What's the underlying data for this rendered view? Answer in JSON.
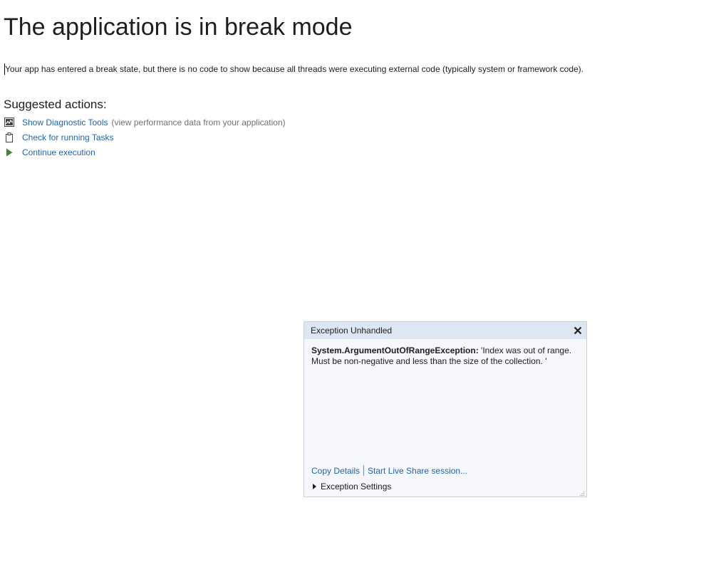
{
  "title": "The application is in break mode",
  "message": "Your app has entered a break state, but there is no code to show because all threads were executing external code (typically system or framework code).",
  "suggested_actions": {
    "heading": "Suggested actions:",
    "items": [
      {
        "label": "Show Diagnostic Tools",
        "hint": "(view performance data from your application)",
        "icon": "diagnostic-tools-icon"
      },
      {
        "label": "Check for running Tasks",
        "hint": "",
        "icon": "clipboard-icon"
      },
      {
        "label": "Continue execution",
        "hint": "",
        "icon": "play-icon"
      }
    ]
  },
  "exception_popup": {
    "title": "Exception Unhandled",
    "exception_type": "System.ArgumentOutOfRangeException:",
    "exception_message_line1": " 'Index was out of range.",
    "exception_message_line2": "Must be non-negative and less than the size of the collection. '",
    "copy_details": "Copy Details",
    "live_share": "Start Live Share session...",
    "settings": "Exception Settings"
  },
  "colors": {
    "link": "#1e64b4",
    "play": "#388a34",
    "popup_header": "#dfe6f3",
    "popup_background": "#f5f7fb"
  }
}
